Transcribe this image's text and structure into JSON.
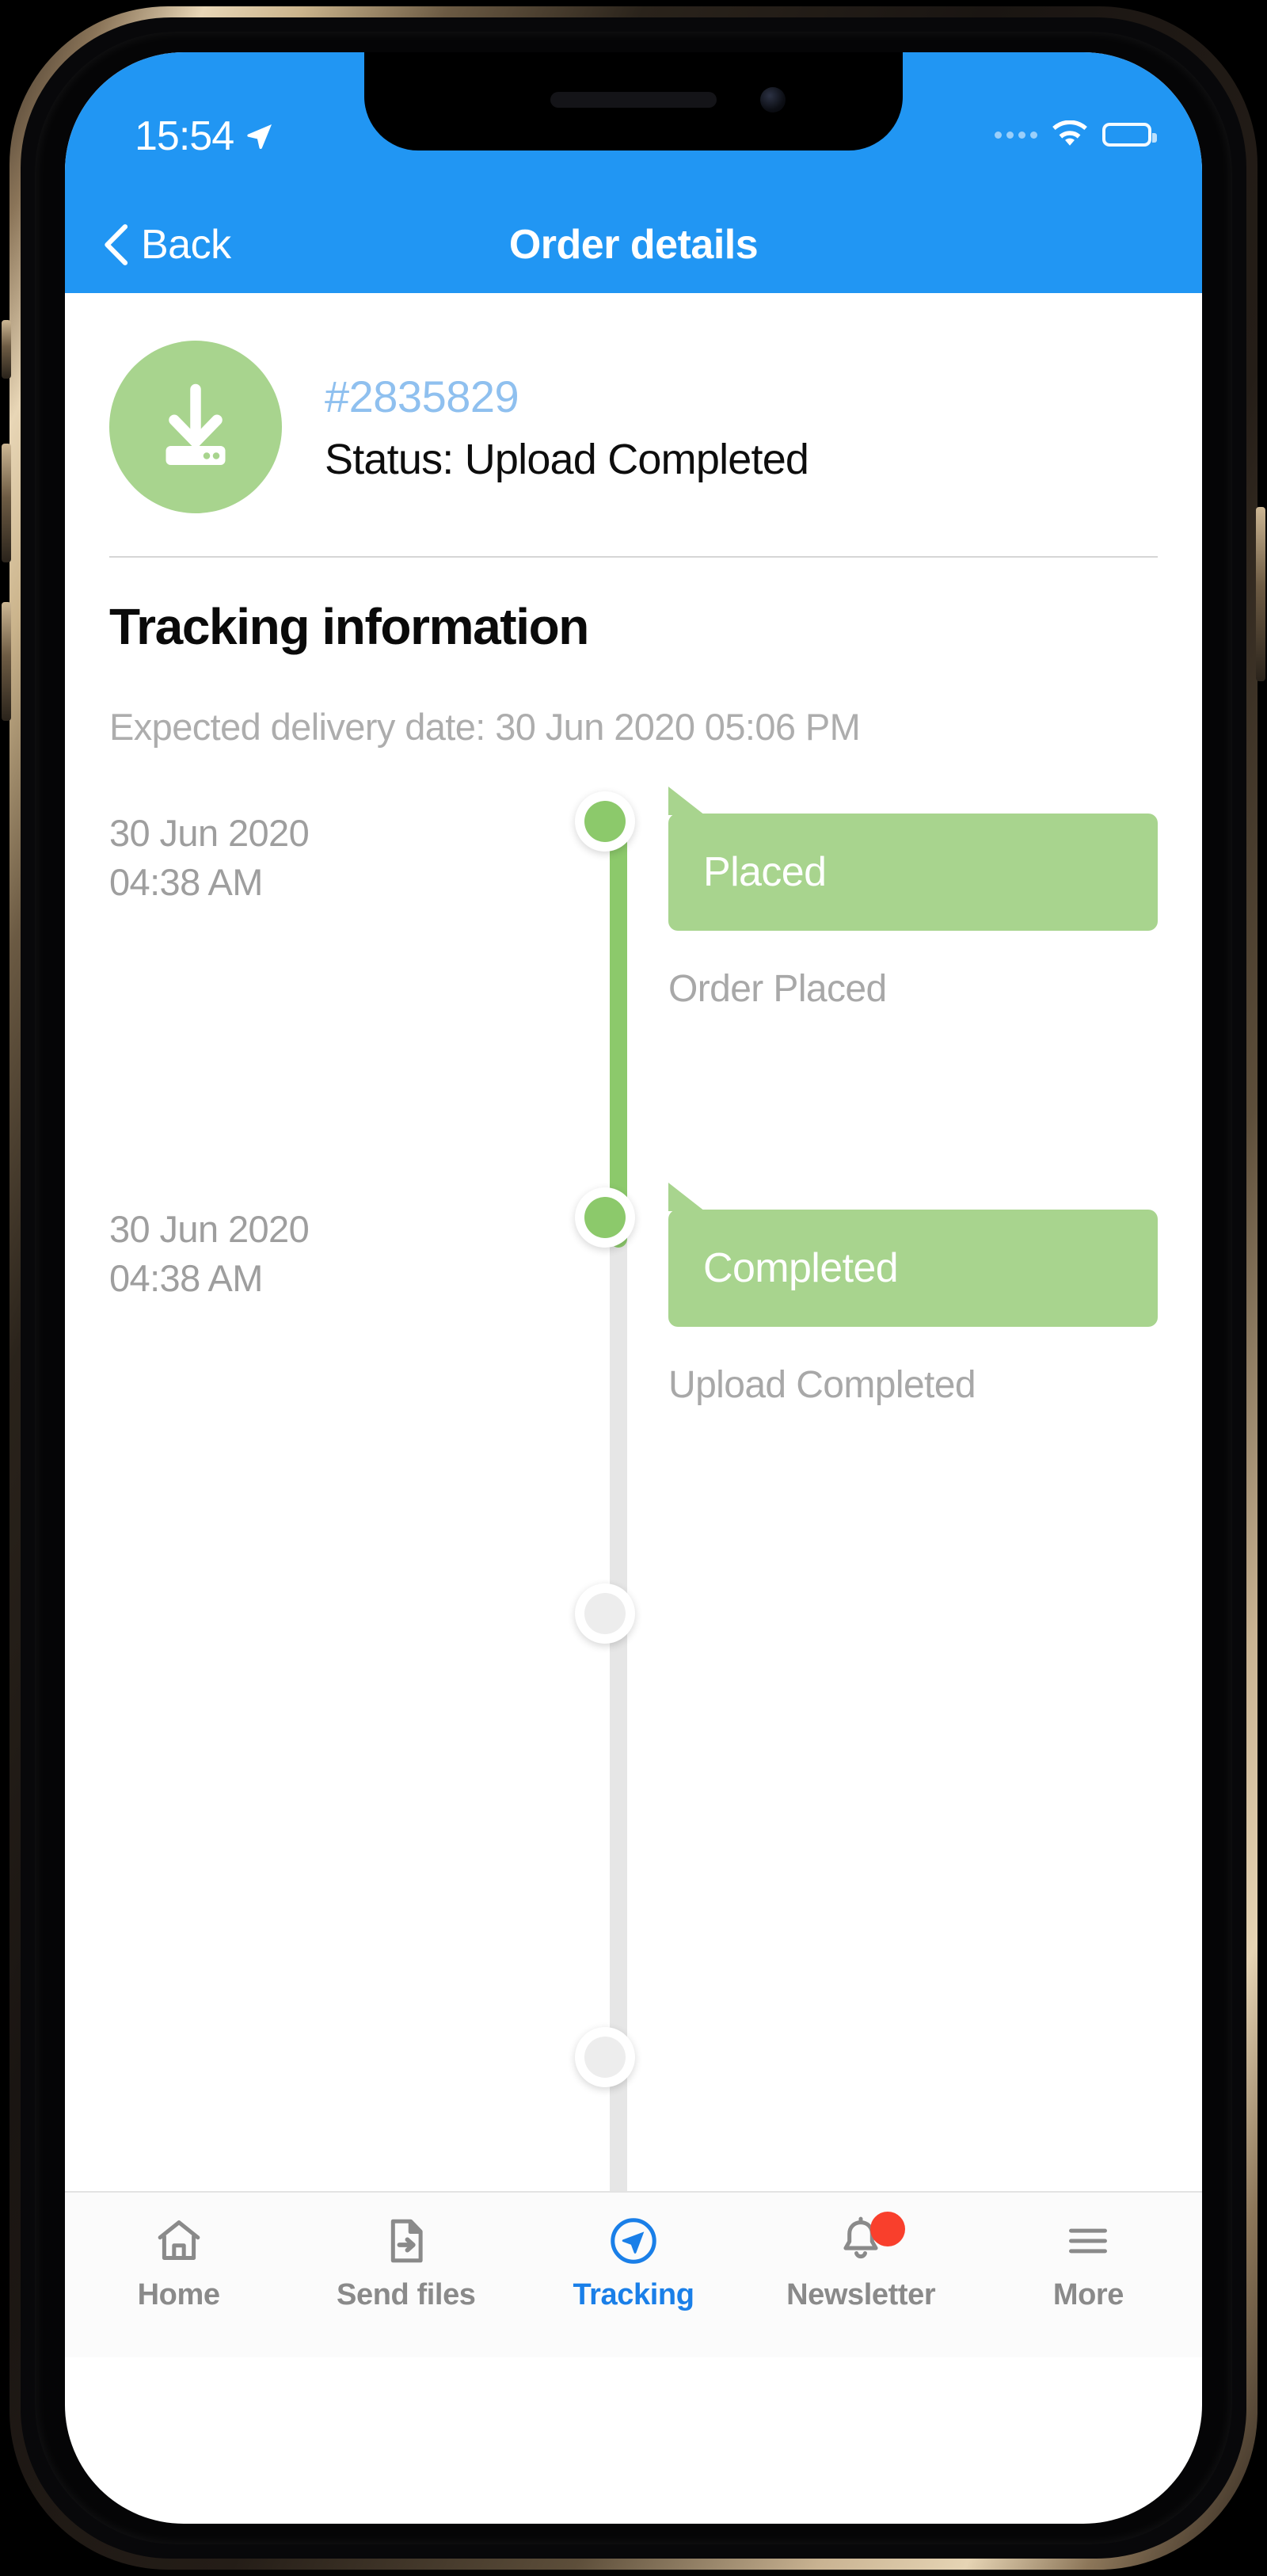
{
  "status_bar": {
    "time": "15:54",
    "location_icon": "location-arrow-icon",
    "signal_icon": "signal-dots-icon",
    "wifi_icon": "wifi-icon",
    "battery_icon": "battery-icon",
    "background_color": "#2196f3"
  },
  "app_bar": {
    "back_label": "Back",
    "back_icon": "chevron-left-icon",
    "title": "Order details",
    "background_color": "#2196f3"
  },
  "order": {
    "status_icon": "download-to-device-icon",
    "status_icon_bg": "#a8d48e",
    "number": "#2835829",
    "number_color": "#8fc0ef",
    "status_text": "Status: Upload Completed"
  },
  "tracking": {
    "title": "Tracking information",
    "expected_delivery": "Expected delivery date: 30 Jun 2020  05:06 PM",
    "accent_green": "#8cc96b",
    "bubble_green": "#a8d48e",
    "track_gray": "#e6e6e6",
    "events": [
      {
        "date": "30 Jun 2020\n04:38 AM",
        "badge": "Placed",
        "description": "Order Placed",
        "state": "done"
      },
      {
        "date": "30 Jun 2020\n04:38 AM",
        "badge": "Completed",
        "description": "Upload Completed",
        "state": "done"
      }
    ]
  },
  "tab_bar": {
    "items": [
      {
        "label": "Home",
        "icon": "home-icon",
        "active": false,
        "badge": false
      },
      {
        "label": "Send files",
        "icon": "file-send-icon",
        "active": false,
        "badge": false
      },
      {
        "label": "Tracking",
        "icon": "paper-plane-icon",
        "active": true,
        "badge": false
      },
      {
        "label": "Newsletter",
        "icon": "bell-icon",
        "active": false,
        "badge": true
      },
      {
        "label": "More",
        "icon": "hamburger-icon",
        "active": false,
        "badge": false
      }
    ],
    "active_color": "#1a7fe8",
    "inactive_color": "#8a8a8a",
    "badge_color": "#f93f2c"
  }
}
